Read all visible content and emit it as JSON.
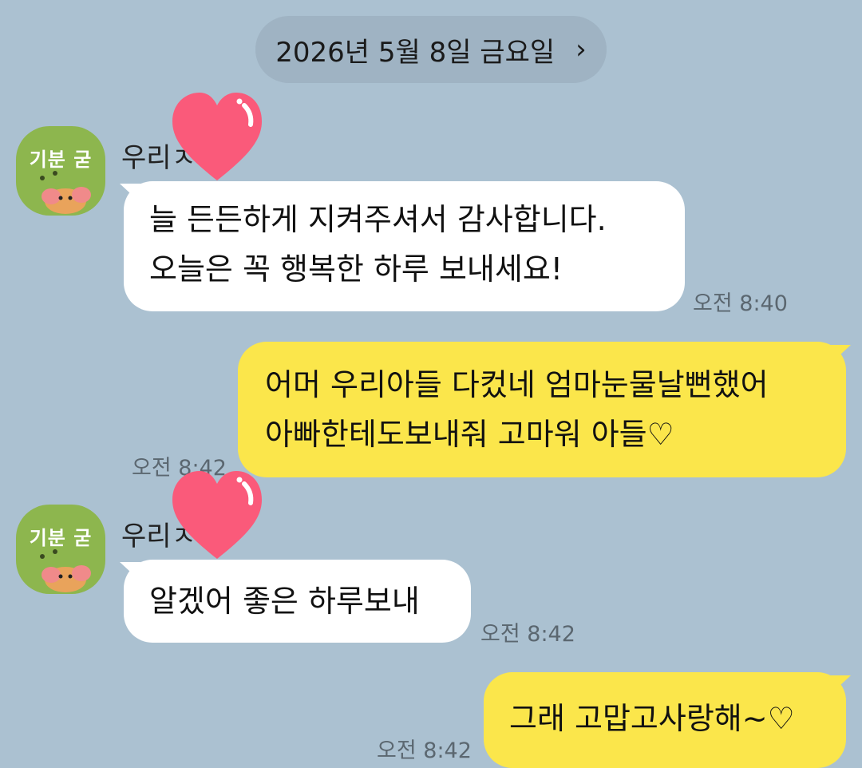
{
  "date_divider": {
    "label": "2026년 5월 8일 금요일",
    "chevron": "›"
  },
  "contact": {
    "name_visible": "우리",
    "name_hidden_suffix_char": "ㅈ",
    "avatar_text": "기분 굳",
    "avatar_icon": "character-emoticon"
  },
  "sticker": {
    "icon": "heart-sticker-icon",
    "color": "#fa5a7a"
  },
  "messages": [
    {
      "side": "incoming",
      "lines": [
        "늘 든든하게 지켜주셔서 감사합니다.",
        "오늘은 꼭 행복한 하루 보내세요!"
      ],
      "time": "오전 8:40"
    },
    {
      "side": "outgoing",
      "lines": [
        "어머 우리아들 다컸네 엄마눈물날뻔했어",
        "아빠한테도보내줘 고마워 아들♡"
      ],
      "time": "오전 8:42"
    },
    {
      "side": "incoming",
      "lines": [
        "알겠어 좋은 하루보내"
      ],
      "time": "오전 8:42"
    },
    {
      "side": "outgoing",
      "lines": [
        "그래 고맙고사랑해~♡"
      ],
      "time": "오전 8:42"
    }
  ],
  "colors": {
    "background": "#abc1d1",
    "outgoing_bubble": "#fbe64b",
    "incoming_bubble": "#ffffff",
    "avatar_bg": "#8db64e"
  }
}
